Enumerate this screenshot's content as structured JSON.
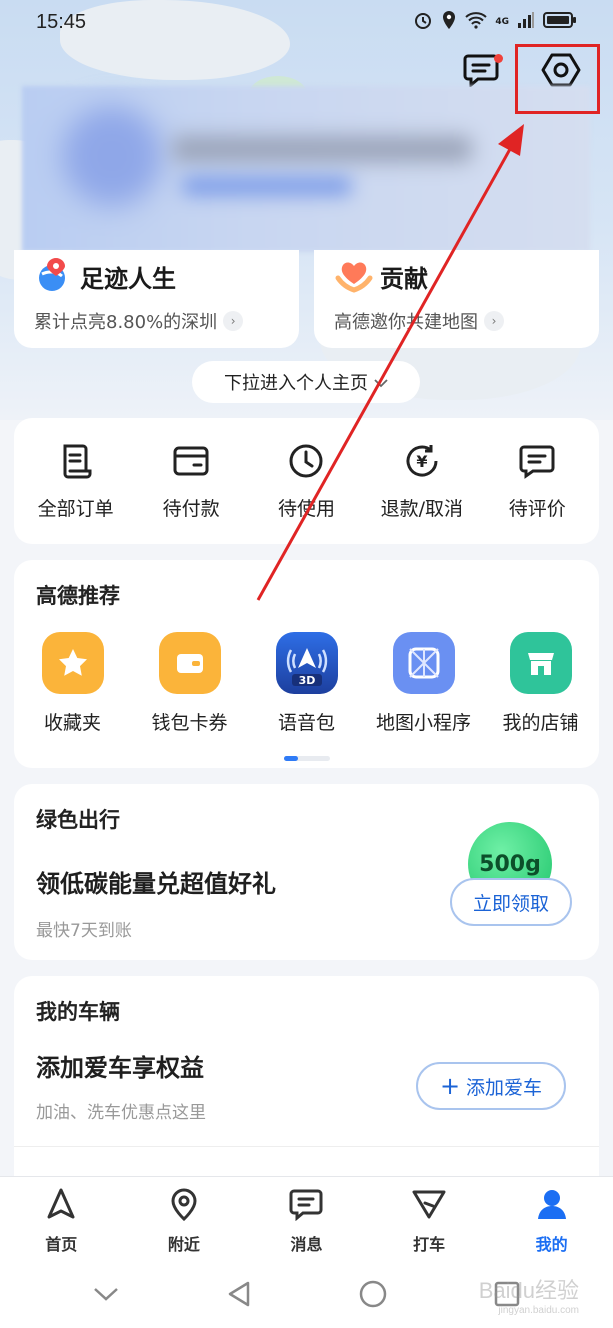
{
  "status_bar": {
    "time": "15:45",
    "network": "4G"
  },
  "header": {
    "messages_badge_color": "#f0413b"
  },
  "life_cards": [
    {
      "title": "足迹人生",
      "subtitle": "累计点亮8.80%的深圳"
    },
    {
      "title": "贡献",
      "subtitle": "高德邀你共建地图"
    }
  ],
  "pull_hint": "下拉进入个人主页",
  "orders": [
    {
      "label": "全部订单",
      "icon": "receipt-icon"
    },
    {
      "label": "待付款",
      "icon": "wallet-icon"
    },
    {
      "label": "待使用",
      "icon": "clock-icon"
    },
    {
      "label": "退款/取消",
      "icon": "refund-icon"
    },
    {
      "label": "待评价",
      "icon": "comment-icon"
    }
  ],
  "recommend": {
    "title": "高德推荐",
    "items": [
      {
        "label": "收藏夹",
        "icon": "star-icon",
        "color": "#fbb43a"
      },
      {
        "label": "钱包卡券",
        "icon": "wallet-icon",
        "color": "#fbb43a"
      },
      {
        "label": "语音包",
        "icon": "voice-3d-icon",
        "color": "#2d5bd8",
        "badge": "3D"
      },
      {
        "label": "地图小程序",
        "icon": "map-app-icon",
        "color": "#6a90f2"
      },
      {
        "label": "我的店铺",
        "icon": "store-icon",
        "color": "#2fc49a"
      }
    ]
  },
  "green_travel": {
    "title": "绿色出行",
    "promo": "领低碳能量兑超值好礼",
    "note": "最快7天到账",
    "energy": "500g",
    "button": "立即领取"
  },
  "vehicle": {
    "title": "我的车辆",
    "promo": "添加爱车享权益",
    "note": "加油、洗车优惠点这里",
    "button": "添加爱车"
  },
  "tabs": [
    {
      "label": "首页",
      "icon": "navigation-arrow-icon"
    },
    {
      "label": "附近",
      "icon": "location-pin-icon"
    },
    {
      "label": "消息",
      "icon": "message-icon"
    },
    {
      "label": "打车",
      "icon": "taxi-icon"
    },
    {
      "label": "我的",
      "icon": "user-icon",
      "active": true
    }
  ],
  "watermark": {
    "brand": "Baidu经验",
    "url": "jingyan.baidu.com"
  },
  "colors": {
    "accent": "#1b6ef3",
    "annotation": "#e02424"
  }
}
